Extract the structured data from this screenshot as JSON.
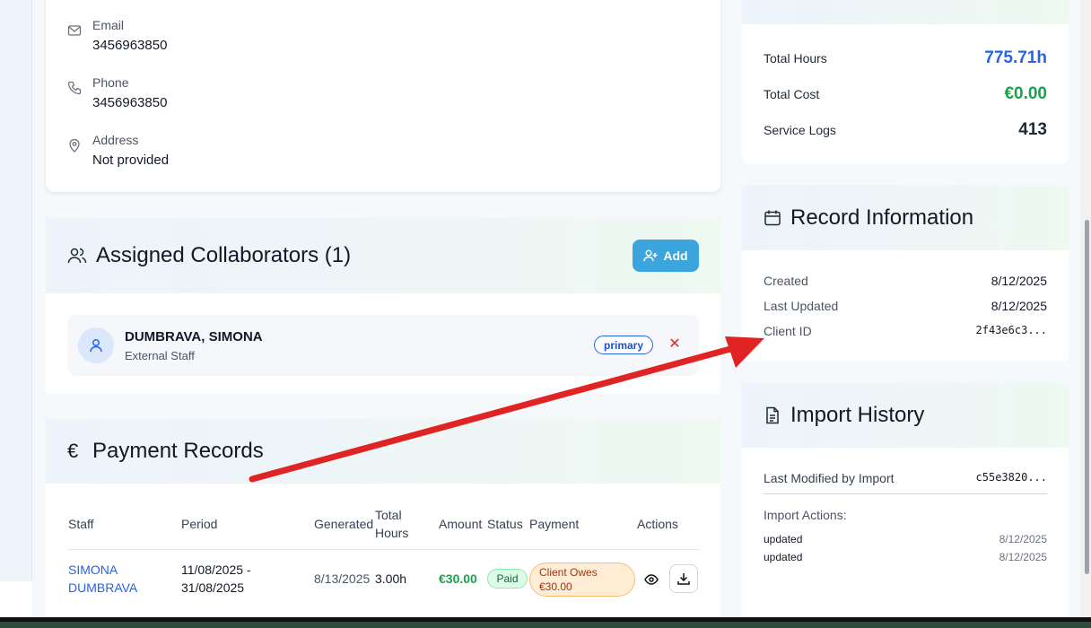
{
  "contact": {
    "email_label": "Email",
    "email_value": "3456963850",
    "phone_label": "Phone",
    "phone_value": "3456963850",
    "address_label": "Address",
    "address_value": "Not provided"
  },
  "collaborators": {
    "title": "Assigned Collaborators (1)",
    "add_label": "Add",
    "items": [
      {
        "name": "DUMBRAVA, SIMONA",
        "role": "External Staff",
        "badge": "primary"
      }
    ]
  },
  "payments": {
    "title": "Payment Records",
    "headers": {
      "staff": "Staff",
      "period": "Period",
      "generated": "Generated",
      "total_hours_1": "Total",
      "total_hours_2": "Hours",
      "amount": "Amount",
      "status": "Status",
      "payment": "Payment",
      "actions": "Actions"
    },
    "rows": [
      {
        "staff_1": "SIMONA",
        "staff_2": "DUMBRAVA",
        "period_1": "11/08/2025 -",
        "period_2": "31/08/2025",
        "generated": "8/13/2025",
        "hours": "3.00h",
        "amount": "€30.00",
        "status": "Paid",
        "payment_1": "Client Owes",
        "payment_2": "€30.00"
      }
    ]
  },
  "stats": {
    "total_hours_label": "Total Hours",
    "total_hours_value": "775.71h",
    "total_cost_label": "Total Cost",
    "total_cost_value": "€0.00",
    "service_logs_label": "Service Logs",
    "service_logs_value": "413"
  },
  "record": {
    "title": "Record Information",
    "created_label": "Created",
    "created_value": "8/12/2025",
    "updated_label": "Last Updated",
    "updated_value": "8/12/2025",
    "client_id_label": "Client ID",
    "client_id_value": "2f43e6c3..."
  },
  "imports": {
    "title": "Import History",
    "last_modified_label": "Last Modified by Import",
    "last_modified_value": "c55e3820...",
    "actions_label": "Import Actions:",
    "actions": [
      {
        "action": "updated",
        "date": "8/12/2025"
      },
      {
        "action": "updated",
        "date": "8/12/2025"
      }
    ]
  },
  "colors": {
    "accent_blue": "#2563eb",
    "green": "#16a34a",
    "add_button": "#3aa6dd",
    "annotation_arrow": "#e02424"
  }
}
